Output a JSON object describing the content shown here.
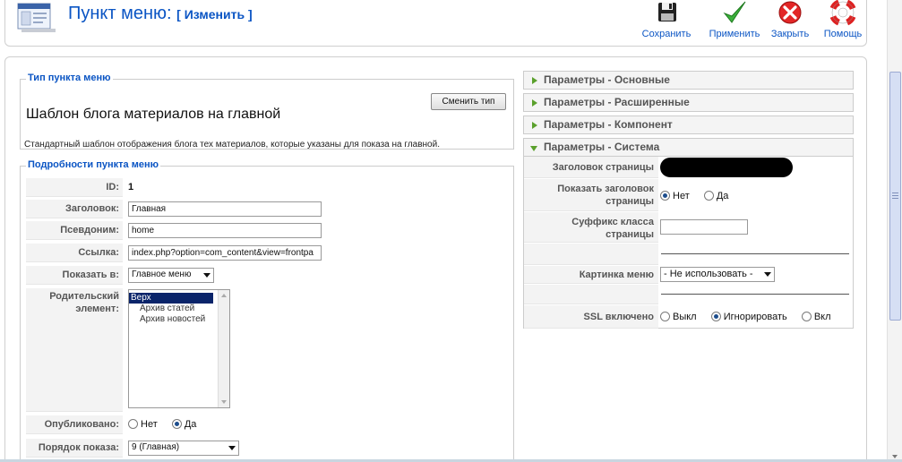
{
  "toolbar": {
    "title": "Пункт меню:",
    "edit_label": "[ Изменить ]",
    "buttons": {
      "save": "Сохранить",
      "apply": "Применить",
      "close": "Закрыть",
      "help": "Помощь"
    }
  },
  "menu_type": {
    "legend": "Тип пункта меню",
    "change_button": "Сменить тип",
    "title": "Шаблон блога материалов на главной",
    "description": "Стандартный шаблон отображения блога тех материалов, которые указаны для показа на главной."
  },
  "details": {
    "legend": "Подробности пункта меню",
    "id_label": "ID:",
    "id_value": "1",
    "title_label": "Заголовок:",
    "title_value": "Главная",
    "alias_label": "Псевдоним:",
    "alias_value": "home",
    "link_label": "Ссылка:",
    "link_value": "index.php?option=com_content&view=frontpa",
    "show_in_label": "Показать в:",
    "show_in_value": "Главное меню",
    "parent_label": "Родительский элемент:",
    "parent_items": [
      "Верх",
      "Архив статей",
      "Архив новостей"
    ],
    "published_label": "Опубликовано:",
    "published_no": "Нет",
    "published_yes": "Да",
    "order_label": "Порядок показа:",
    "order_value": "9 (Главная)"
  },
  "params": {
    "basic": "Параметры - Основные",
    "advanced": "Параметры - Расширенные",
    "component": "Параметры - Компонент",
    "system": "Параметры - Система",
    "page_title_label": "Заголовок страницы",
    "show_page_title_label": "Показать заголовок страницы",
    "no": "Нет",
    "yes": "Да",
    "page_class_suffix_label": "Суффикс класса страницы",
    "menu_image_label": "Картинка меню",
    "menu_image_value": "- Не использовать -",
    "ssl_label": "SSL включено",
    "ssl_off": "Выкл",
    "ssl_ignore": "Игнорировать",
    "ssl_on": "Вкл"
  },
  "colors": {
    "accent": "#0b55c4",
    "pane_arrow": "#5aa02c"
  }
}
